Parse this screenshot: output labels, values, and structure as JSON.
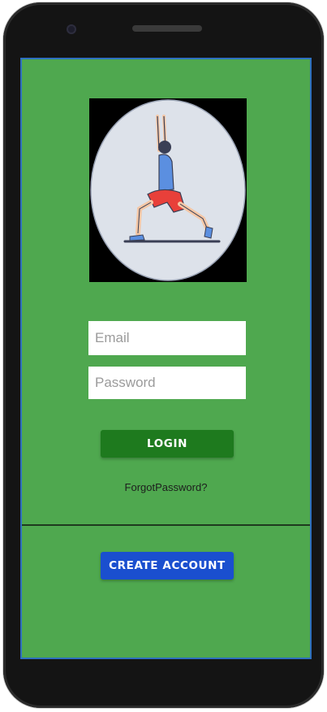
{
  "login_form": {
    "email_placeholder": "Email",
    "password_placeholder": "Password",
    "login_label": "LOGIN",
    "forgot_label": "ForgotPassword?",
    "create_account_label": "CREATE ACCOUNT"
  },
  "icons": {
    "hero": "yoga-warrior-pose-icon"
  },
  "colors": {
    "screen_background": "#4fa84f",
    "login_button": "#1e7a1e",
    "create_button": "#1a4fcf"
  }
}
